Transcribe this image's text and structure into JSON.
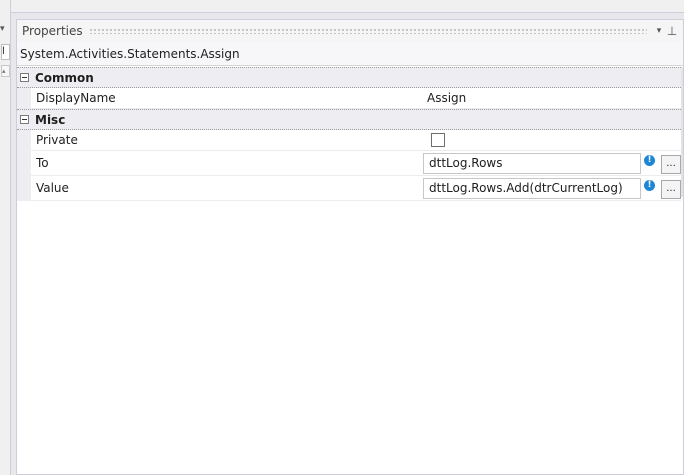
{
  "left_strip": {
    "label": "l"
  },
  "panel": {
    "title": "Properties",
    "dropdown_glyph": "▾",
    "pin_glyph": "⊥"
  },
  "object_type": "System.Activities.Statements.Assign",
  "categories": [
    {
      "name": "Common",
      "properties": [
        {
          "name": "DisplayName",
          "value": "Assign"
        }
      ]
    },
    {
      "name": "Misc",
      "properties": [
        {
          "name": "Private",
          "checked": false
        },
        {
          "name": "To",
          "value": "dttLog.Rows"
        },
        {
          "name": "Value",
          "value": "dttLog.Rows.Add(dtrCurrentLog)"
        }
      ]
    }
  ],
  "icons": {
    "warning": "!",
    "ellipsis": "...",
    "collapse": "minus-box"
  },
  "colors": {
    "warning_blue": "#1f86d6",
    "category_bg": "#eeeef2"
  }
}
